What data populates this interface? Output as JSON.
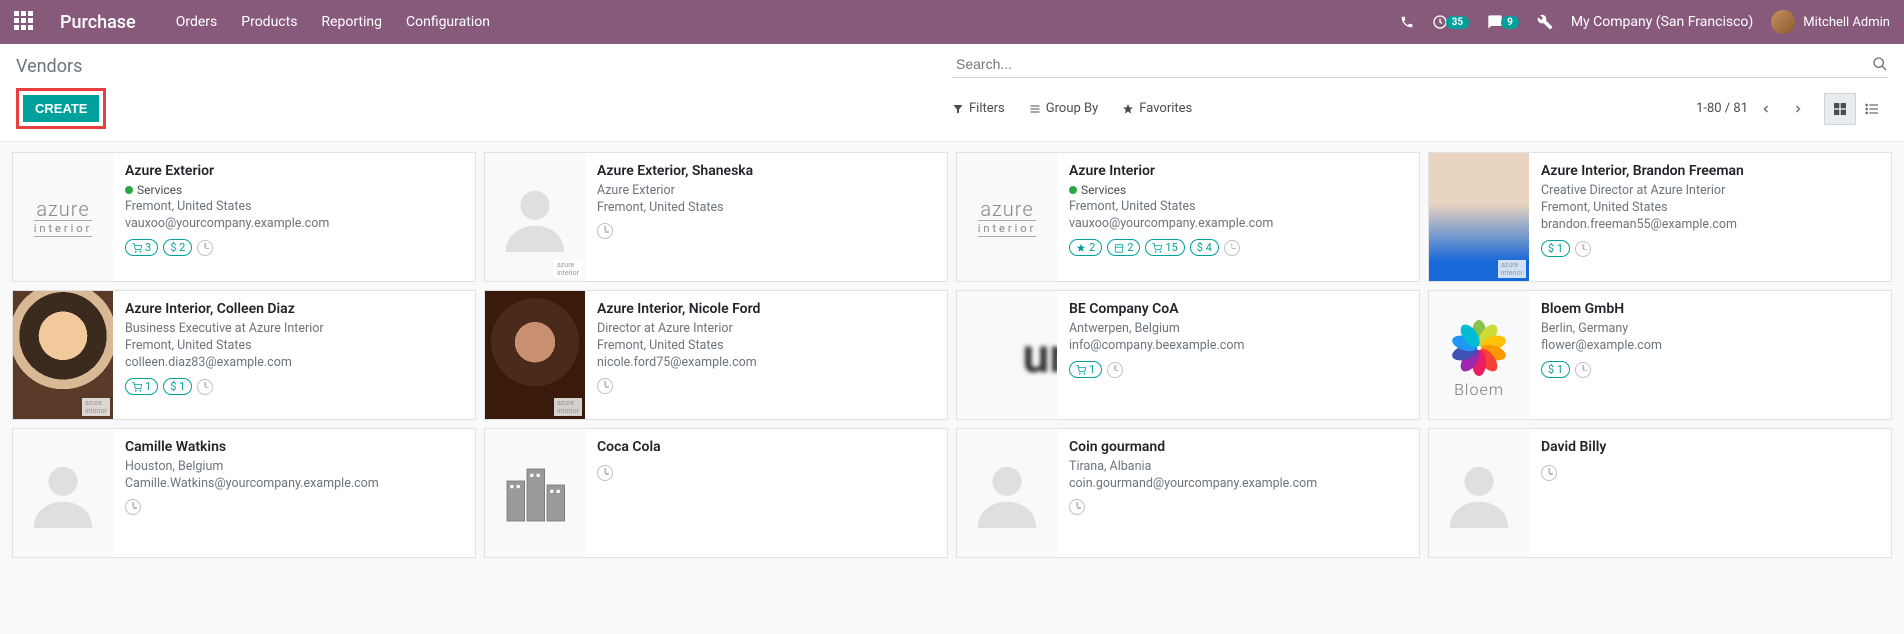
{
  "header": {
    "app_title": "Purchase",
    "nav": [
      "Orders",
      "Products",
      "Reporting",
      "Configuration"
    ],
    "activity_count": "35",
    "message_count": "9",
    "company": "My Company (San Francisco)",
    "user": "Mitchell Admin"
  },
  "breadcrumb": "Vendors",
  "buttons": {
    "create": "CREATE"
  },
  "search": {
    "placeholder": "Search..."
  },
  "filters": {
    "filters": "Filters",
    "group_by": "Group By",
    "favorites": "Favorites"
  },
  "pager": {
    "range": "1-80 / 81"
  },
  "cards": [
    {
      "title": "Azure Exterior",
      "tag": "Services",
      "subtitle": "",
      "location": "Fremont, United States",
      "email": "vauxoo@yourcompany.example.com",
      "pills": [
        {
          "icon": "cart",
          "text": "3"
        },
        {
          "icon": "dollar",
          "text": "$ 2"
        }
      ],
      "img": "azure",
      "clock": true
    },
    {
      "title": "Azure Exterior, Shaneska",
      "subtitle": "Azure Exterior",
      "location": "Fremont, United States",
      "email": "",
      "pills": [],
      "img": "placeholder",
      "corner": "azure",
      "clock": true
    },
    {
      "title": "Azure Interior",
      "tag": "Services",
      "subtitle": "",
      "location": "Fremont, United States",
      "email": "vauxoo@yourcompany.example.com",
      "pills": [
        {
          "icon": "star",
          "text": "2"
        },
        {
          "icon": "cal",
          "text": "2"
        },
        {
          "icon": "cart",
          "text": "15"
        },
        {
          "icon": "dollar",
          "text": "$ 4"
        }
      ],
      "img": "azure",
      "clock": true
    },
    {
      "title": "Azure Interior, Brandon Freeman",
      "subtitle": "Creative Director at Azure Interior",
      "location": "Fremont, United States",
      "email": "brandon.freeman55@example.com",
      "pills": [
        {
          "icon": "dollar",
          "text": "$ 1"
        }
      ],
      "img": "brandon",
      "corner": "azure",
      "clock": true
    },
    {
      "title": "Azure Interior, Colleen Diaz",
      "subtitle": "Business Executive at Azure Interior",
      "location": "Fremont, United States",
      "email": "colleen.diaz83@example.com",
      "pills": [
        {
          "icon": "cart",
          "text": "1"
        },
        {
          "icon": "dollar",
          "text": "$ 1"
        }
      ],
      "img": "colleen",
      "corner": "azure",
      "clock": true
    },
    {
      "title": "Azure Interior, Nicole Ford",
      "subtitle": "Director at Azure Interior",
      "location": "Fremont, United States",
      "email": "nicole.ford75@example.com",
      "pills": [],
      "img": "nicole",
      "corner": "azure",
      "clock": true
    },
    {
      "title": "BE Company CoA",
      "subtitle": "",
      "location": "Antwerpen, Belgium",
      "email": "info@company.beexample.com",
      "pills": [
        {
          "icon": "cart",
          "text": "1"
        }
      ],
      "img": "be",
      "clock": true
    },
    {
      "title": "Bloem GmbH",
      "subtitle": "",
      "location": "Berlin, Germany",
      "email": "flower@example.com",
      "pills": [
        {
          "icon": "dollar",
          "text": "$ 1"
        }
      ],
      "img": "bloem",
      "clock": true
    },
    {
      "title": "Camille Watkins",
      "subtitle": "",
      "location": "Houston, Belgium",
      "email": "Camille.Watkins@yourcompany.example.com",
      "pills": [],
      "img": "placeholder",
      "clock": true
    },
    {
      "title": "Coca Cola",
      "subtitle": "",
      "location": "",
      "email": "",
      "pills": [],
      "img": "buildings",
      "clock": true
    },
    {
      "title": "Coin gourmand",
      "subtitle": "",
      "location": "Tirana, Albania",
      "email": "coin.gourmand@yourcompany.example.com",
      "pills": [],
      "img": "placeholder",
      "clock": true
    },
    {
      "title": "David Billy",
      "subtitle": "",
      "location": "",
      "email": "",
      "pills": [],
      "img": "placeholder",
      "clock": true
    }
  ]
}
